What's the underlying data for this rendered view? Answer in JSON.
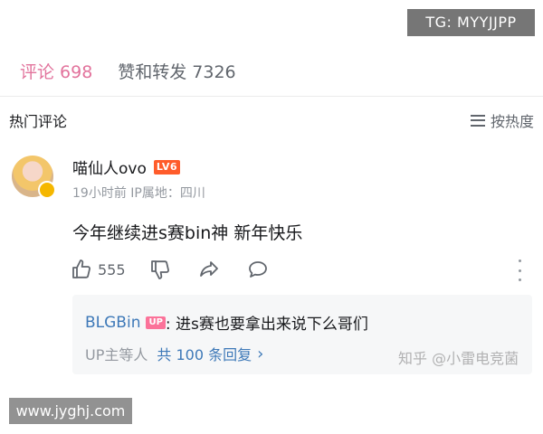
{
  "watermarks": {
    "top_right": "TG: MYYJJPP",
    "bottom_left": "www.jyghj.com",
    "zhihu": "知乎 @小雷电竞菌"
  },
  "tabs": [
    {
      "label": "评论",
      "count": "698",
      "active": true
    },
    {
      "label": "赞和转发",
      "count": "7326",
      "active": false
    }
  ],
  "sort": {
    "title": "热门评论",
    "button_label": "按热度",
    "icon": "menu-lines-icon"
  },
  "comment": {
    "username": "喵仙人ovo",
    "level_badge": "LV6",
    "meta": "19小时前 IP属地：四川",
    "text": "今年继续进s赛bin神 新年快乐",
    "like_count": "555",
    "icons": [
      "thumbs-up-icon",
      "thumbs-down-icon",
      "share-icon",
      "reply-bubble-icon",
      "more-vertical-icon"
    ]
  },
  "reply": {
    "username": "BLGBin",
    "up_badge": "UP",
    "text": ": 进s赛也要拿出来说下么哥们",
    "up_label": "UP主等人",
    "total_replies": "共 100 条回复",
    "chevron": "›"
  },
  "colors": {
    "accent_pink": "#e2739c",
    "link_blue": "#3e79b8",
    "level_orange": "#ff5c2b",
    "up_pink": "#fb7299"
  }
}
